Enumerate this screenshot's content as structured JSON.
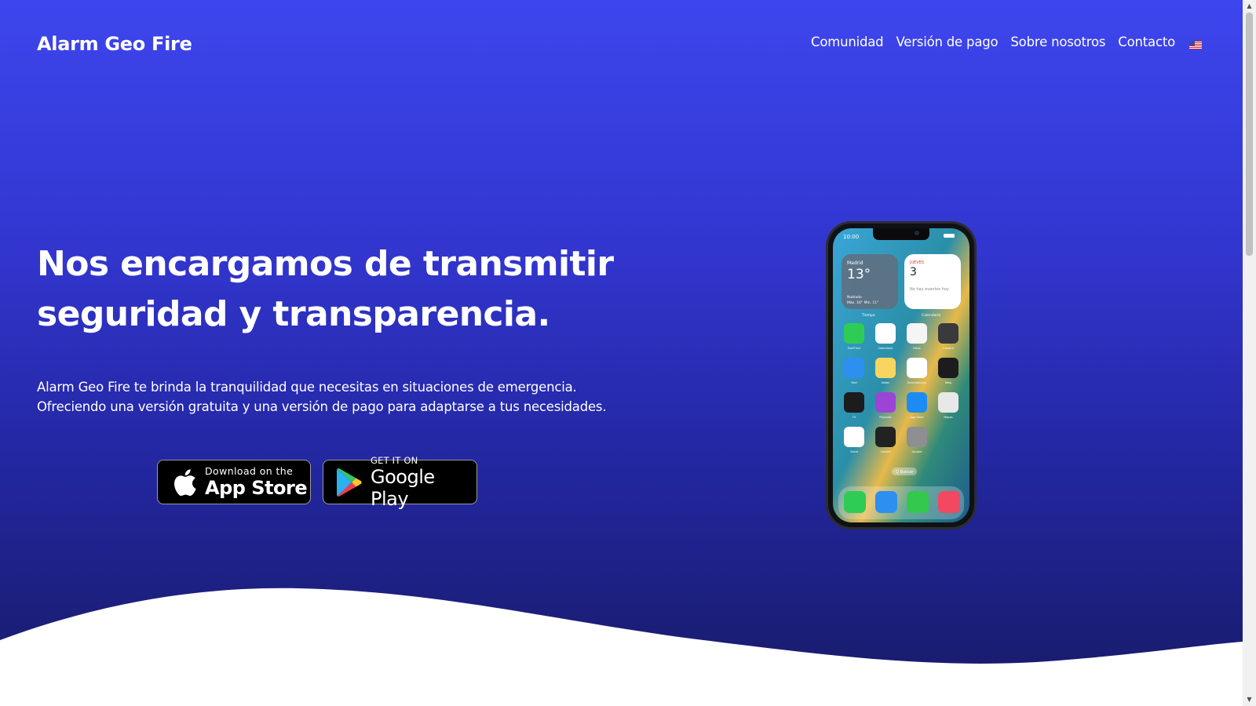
{
  "header": {
    "brand": "Alarm Geo Fire",
    "nav": [
      {
        "label": "Comunidad"
      },
      {
        "label": "Versión de pago"
      },
      {
        "label": "Sobre nosotros"
      },
      {
        "label": "Contacto"
      }
    ],
    "language_flag_icon": "us-flag-icon"
  },
  "hero": {
    "headline_line1": "Nos encargamos de transmitir",
    "headline_line2": "seguridad y transparencia.",
    "description_line1": "Alarm Geo Fire te brinda la tranquilidad que necesitas en situaciones de emergencia.",
    "description_line2": "Ofreciendo una versión gratuita y una versión de pago para adaptarse a tus necesidades.",
    "appstore": {
      "small": "Download on the",
      "big": "App Store",
      "icon": "apple-icon"
    },
    "googleplay": {
      "small": "GET IT ON",
      "big": "Google Play",
      "icon": "google-play-icon"
    }
  },
  "phone": {
    "time": "10:00",
    "weather_city": "Madrid",
    "weather_temp": "13°",
    "weather_cond": "Nublado",
    "weather_range": "Máx. 16° Mín. 11°",
    "weather_label": "Tiempo",
    "cal_day": "JUEVES",
    "cal_date": "3",
    "cal_note": "No hay eventos hoy",
    "cal_label": "Calendario",
    "search_pill": "Q Buscar",
    "app_labels": [
      "FaceTime",
      "Calendario",
      "Fotos",
      "Cámara",
      "Mail",
      "Notas",
      "Recordatorios",
      "Reloj",
      "TV",
      "Podcasts",
      "App Store",
      "Mapas",
      "Salud",
      "Cartera",
      "Ajustes"
    ]
  },
  "colors": {
    "gradient_top": "#3d46ee",
    "gradient_bottom": "#171a66",
    "text": "#ffffff",
    "button_bg": "#000000"
  }
}
